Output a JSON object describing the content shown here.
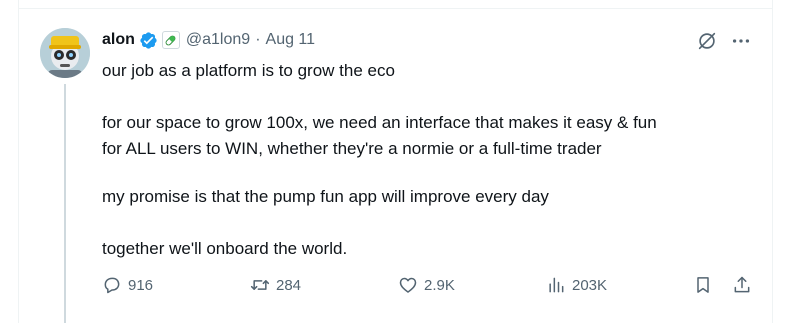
{
  "post": {
    "author_name": "alon",
    "handle": "@a1lon9",
    "separator": "·",
    "date": "Aug 11",
    "paragraphs": [
      "our job as a platform is to grow the eco",
      "for our space to grow 100x, we need an interface that makes it easy & fun\nfor ALL users to WIN, whether they're a normie or a full-time trader",
      "my promise is that the pump fun app will improve every day",
      "together we'll onboard the world."
    ],
    "stats": {
      "replies": "916",
      "reposts": "284",
      "likes": "2.9K",
      "views": "203K"
    }
  },
  "colors": {
    "verified_blue": "#1d9bf0",
    "secondary_text": "#536471",
    "primary_text": "#0f1419",
    "thread_line": "#cfd9de"
  },
  "icons": {
    "verified": "verified-badge-icon",
    "affiliation": "pill-icon",
    "grok": "grok-icon",
    "more": "more-icon",
    "reply": "reply-icon",
    "repost": "repost-icon",
    "like": "heart-icon",
    "views": "views-icon",
    "bookmark": "bookmark-icon",
    "share": "share-icon"
  }
}
